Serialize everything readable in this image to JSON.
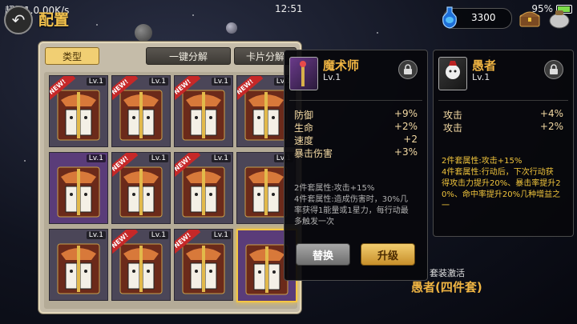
{
  "status": {
    "network": "超级1.0.00K/s",
    "time": "12:51",
    "battery": "95%"
  },
  "header": {
    "title": "配置",
    "currency_value": "3300"
  },
  "panel": {
    "tabs": {
      "type": "类型",
      "one_click": "一键分解",
      "card_decompose": "卡片分解"
    },
    "cards": [
      {
        "level": "Lv.1",
        "new_badge": "NEW!",
        "frame": "gray"
      },
      {
        "level": "Lv.1",
        "new_badge": "NEW!",
        "frame": "gray"
      },
      {
        "level": "Lv.1",
        "new_badge": "NEW!",
        "frame": "gray"
      },
      {
        "level": "Lv.1",
        "new_badge": "NEW!",
        "frame": "gray"
      },
      {
        "level": "Lv.1",
        "new_badge": "",
        "frame": "purple"
      },
      {
        "level": "Lv.1",
        "new_badge": "NEW!",
        "frame": "gray"
      },
      {
        "level": "Lv.1",
        "new_badge": "NEW!",
        "frame": "gray"
      },
      {
        "level": "Lv.1",
        "new_badge": "",
        "frame": "gray"
      },
      {
        "level": "Lv.1",
        "new_badge": "",
        "frame": "gray"
      },
      {
        "level": "Lv.1",
        "new_badge": "NEW!",
        "frame": "gray"
      },
      {
        "level": "Lv.1",
        "new_badge": "NEW!",
        "frame": "gray"
      },
      {
        "level": "",
        "new_badge": "",
        "frame": "purple",
        "selected": true
      }
    ]
  },
  "detail_left": {
    "name": "魔术师",
    "level": "Lv.1",
    "stats": [
      {
        "label": "防御",
        "value": "+9%"
      },
      {
        "label": "生命",
        "value": "+2%"
      },
      {
        "label": "速度",
        "value": "+2"
      },
      {
        "label": "暴击伤害",
        "value": "+3%"
      }
    ],
    "set_desc": [
      "2件套属性:攻击+15%",
      "4件套属性:造成伤害时，30%几",
      "率获得1能量或1星力，每行动最",
      "多触发一次"
    ],
    "replace_label": "替换",
    "upgrade_label": "升级"
  },
  "detail_right": {
    "name": "愚者",
    "level": "Lv.1",
    "stats": [
      {
        "label": "攻击",
        "value": "+4%"
      },
      {
        "label": "攻击",
        "value": "+2%"
      }
    ],
    "set_desc": [
      "2件套属性:攻击+15%",
      "4件套属性:行动后，下次行动获",
      "得攻击力提升20%、暴击率提升2",
      "0%、命中率提升20%几种增益之",
      "一"
    ]
  },
  "set_activation": {
    "label": "套装激活",
    "name": "愚者(四件套)"
  },
  "colors": {
    "accent_gold": "#f0b543",
    "stat_text": "#f3d9a3",
    "set_active": "#f0c43c"
  }
}
